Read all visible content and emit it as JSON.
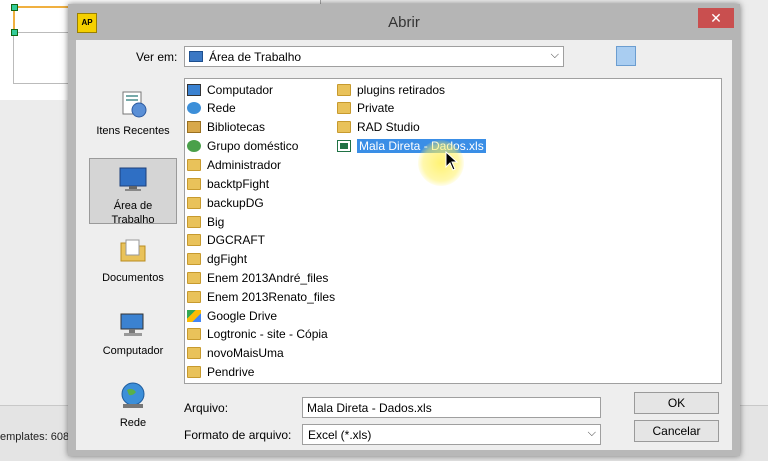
{
  "background": {
    "status_text": "emplates: 608"
  },
  "dialog": {
    "app_icon": "AP",
    "title": "Abrir",
    "close_glyph": "✕"
  },
  "lookin": {
    "label": "Ver em:",
    "value": "Área de Trabalho"
  },
  "places": [
    {
      "label": "Itens Recentes",
      "icon": "recent-items-icon"
    },
    {
      "label": "Área de Trabalho",
      "icon": "desktop-icon",
      "selected": true
    },
    {
      "label": "Documentos",
      "icon": "documents-icon"
    },
    {
      "label": "Computador",
      "icon": "computer-icon"
    },
    {
      "label": "Rede",
      "icon": "network-icon"
    }
  ],
  "files_col1": [
    {
      "name": "Computador",
      "icon": "computer-icon"
    },
    {
      "name": "Rede",
      "icon": "network-icon"
    },
    {
      "name": "Bibliotecas",
      "icon": "libraries-icon"
    },
    {
      "name": "Grupo doméstico",
      "icon": "homegroup-icon"
    },
    {
      "name": "Administrador",
      "icon": "user-folder-icon"
    },
    {
      "name": "backtpFight",
      "icon": "folder-icon"
    },
    {
      "name": "backupDG",
      "icon": "folder-icon"
    },
    {
      "name": "Big",
      "icon": "folder-icon"
    },
    {
      "name": "DGCRAFT",
      "icon": "folder-icon"
    },
    {
      "name": "dgFight",
      "icon": "folder-icon"
    },
    {
      "name": "Enem 2013André_files",
      "icon": "folder-icon"
    },
    {
      "name": "Enem 2013Renato_files",
      "icon": "folder-icon"
    },
    {
      "name": "Google Drive",
      "icon": "google-drive-icon"
    },
    {
      "name": "Logtronic - site - Cópia",
      "icon": "folder-icon"
    },
    {
      "name": "novoMaisUma",
      "icon": "folder-icon"
    },
    {
      "name": "Pendrive",
      "icon": "folder-icon"
    }
  ],
  "files_col2": [
    {
      "name": "plugins retirados",
      "icon": "folder-icon"
    },
    {
      "name": "Private",
      "icon": "folder-icon"
    },
    {
      "name": "RAD Studio",
      "icon": "folder-icon"
    },
    {
      "name": "Mala Direta - Dados.xls",
      "icon": "excel-file-icon",
      "selected": true
    }
  ],
  "filename": {
    "label": "Arquivo:",
    "value": "Mala Direta - Dados.xls"
  },
  "filetype": {
    "label": "Formato de arquivo:",
    "value": "Excel (*.xls)"
  },
  "buttons": {
    "ok": "OK",
    "cancel": "Cancelar"
  }
}
